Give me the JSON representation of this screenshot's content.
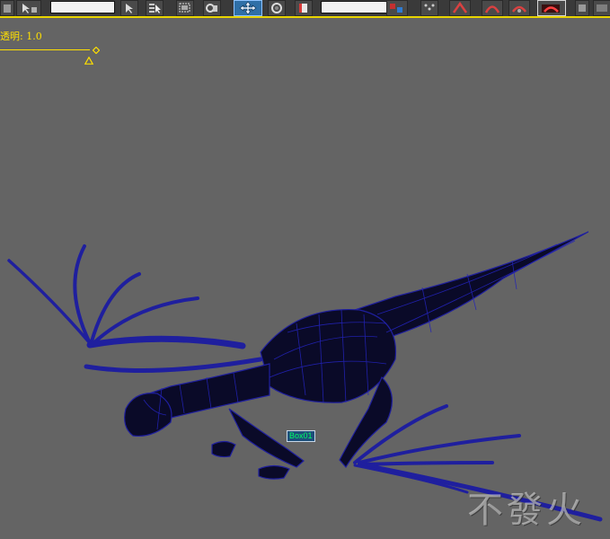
{
  "viewport": {
    "opacity_label": "透明: 1.0",
    "object_label": "Box01",
    "watermark": "不發火",
    "wire_color": "#1f1f9e",
    "body_color": "#0a0a28"
  },
  "toolbar": {
    "icons": [
      "viewport-icon",
      "select-object-icon",
      "select-by-name-icon",
      "rectangular-selection-icon",
      "window-crossing-icon",
      "select-and-move-icon",
      "select-and-rotate-icon",
      "select-and-scale-icon",
      "snaps-toggle-icon",
      "angle-snap-icon",
      "percent-snap-icon",
      "mirror-icon",
      "align-icon",
      "curve-editor-icon"
    ],
    "accent": "#e8d400",
    "active_color": "#2f6fa7"
  }
}
